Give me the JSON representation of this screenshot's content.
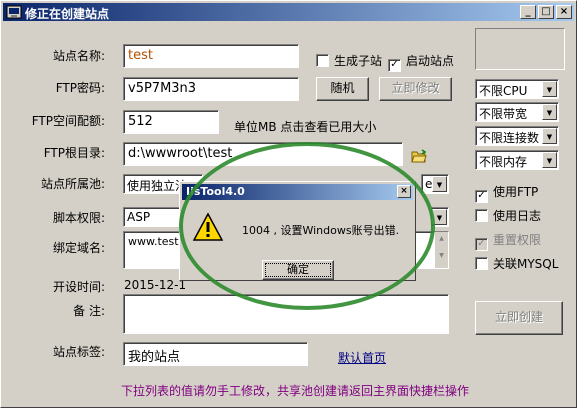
{
  "window": {
    "title": "修正在创建站点"
  },
  "form": {
    "site_name_label": "站点名称:",
    "site_name_value": "test",
    "create_subsite_label": "生成子站",
    "enable_site_label": "启动站点",
    "ftp_password_label": "FTP密码:",
    "ftp_password_value": "v5P7M3n3",
    "random_button": "随机",
    "modify_now_button": "立即修改",
    "ftp_quota_label": "FTP空间配额:",
    "ftp_quota_value": "512",
    "quota_hint": "单位MB 点击查看已用大小",
    "ftp_root_label": "FTP根目录:",
    "ftp_root_value": "d:\\wwwroot\\test",
    "site_pool_label": "站点所属池:",
    "site_pool_value": "使用独立池",
    "site_pool_value2": "e",
    "script_perm_label": "脚本权限:",
    "script_perm_value": "ASP",
    "bind_domain_label": "绑定域名:",
    "bind_domain_value": "www.test.c",
    "open_time_label": "开设时间:",
    "open_time_value": "2015-12-1",
    "remark_label": "备 注:",
    "remark_value": "",
    "site_tag_label": "站点标签:",
    "site_tag_value": "我的站点",
    "default_home_link": "默认首页",
    "bottom_hint": "下拉列表的值请勿手工修改，共享池创建请返回主界面快捷栏操作"
  },
  "right_panel": {
    "cpu_limit": "不限CPU",
    "bandwidth_limit": "不限带宽",
    "connection_limit": "不限连接数",
    "memory_limit": "不限内存",
    "use_ftp_label": "使用FTP",
    "use_log_label": "使用日志",
    "reset_perm_label": "重置权限",
    "link_mysql_label": "关联MYSQL",
    "create_now_button": "立即创建"
  },
  "dialog": {
    "title": "IisTool4.0",
    "message": "1004 , 设置Windows账号出错.",
    "ok_button": "确定"
  },
  "colors": {
    "titlebar": "#0a246a",
    "annotation_circle": "#2e8b2e",
    "site_name_text": "#b05000",
    "hint_text": "#800080"
  }
}
